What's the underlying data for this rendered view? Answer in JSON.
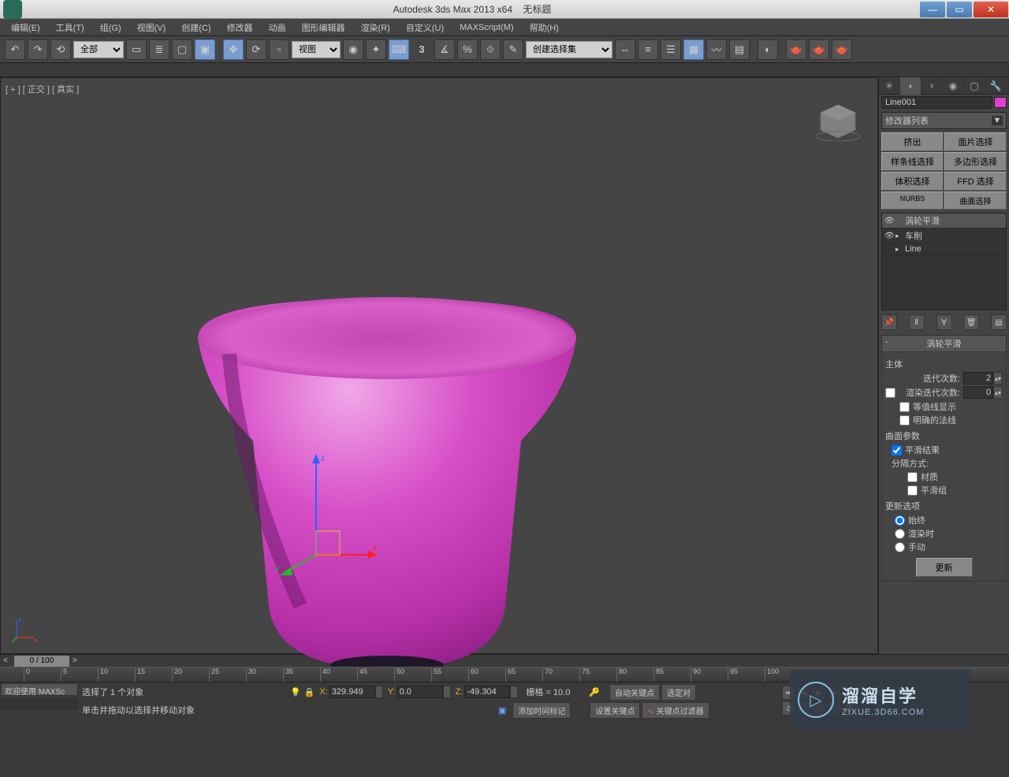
{
  "title": {
    "app": "Autodesk 3ds Max  2013 x64",
    "doc": "无标题"
  },
  "menu": [
    "编辑(E)",
    "工具(T)",
    "组(G)",
    "视图(V)",
    "创建(C)",
    "修改器",
    "动画",
    "图形编辑器",
    "渲染(R)",
    "自定义(U)",
    "MAXScript(M)",
    "帮助(H)"
  ],
  "toolbar": {
    "selFilter": "全部",
    "refCoord": "视图",
    "namedSet": "创建选择集"
  },
  "viewport": {
    "label": "[ + ] [ 正交 ] [ 真实 ]"
  },
  "sidepanel": {
    "objName": "Line001",
    "modList": "修改器列表",
    "modButtons": [
      "挤出",
      "面片选择",
      "样条线选择",
      "多边形选择",
      "体积选择",
      "FFD 选择",
      "NURBS",
      "曲面选择"
    ],
    "stack": [
      "涡轮平滑",
      "车削",
      "Line"
    ],
    "rollout": {
      "title": "涡轮平滑",
      "mainLabel": "主体",
      "iterLabel": "迭代次数:",
      "iterVal": "2",
      "renderIterLabel": "渲染迭代次数:",
      "renderIterVal": "0",
      "isoline": "等值线显示",
      "explicitNormals": "明确的法线",
      "surfParams": "曲面参数",
      "smoothResult": "平滑结果",
      "sepBy": "分隔方式:",
      "material": "材质",
      "smoothGroup": "平滑组",
      "updateOpts": "更新选项",
      "always": "始终",
      "onRender": "渲染时",
      "manual": "手动",
      "updateBtn": "更新"
    }
  },
  "timeline": {
    "pos": "0 / 100",
    "ticks": [
      0,
      5,
      10,
      15,
      20,
      25,
      30,
      35,
      40,
      45,
      50,
      55,
      60,
      65,
      70,
      75,
      80,
      85,
      90,
      95,
      100
    ]
  },
  "status": {
    "welcome": "欢迎使用",
    "maxs": "MAXSc",
    "selInfo": "选择了 1 个对象",
    "hint": "单击并拖动以选择并移动对象",
    "x": "329.949",
    "y": "0.0",
    "z": "-49.304",
    "grid": "栅格 = 10.0",
    "addTimeTag": "添加时间标记",
    "autoKey": "自动关键点",
    "selOnly": "选定对",
    "setKey": "设置关键点",
    "keyFilters": "关键点过滤器"
  },
  "watermark": {
    "cn": "溜溜自学",
    "en": "ZIXUE.3D66.COM"
  }
}
